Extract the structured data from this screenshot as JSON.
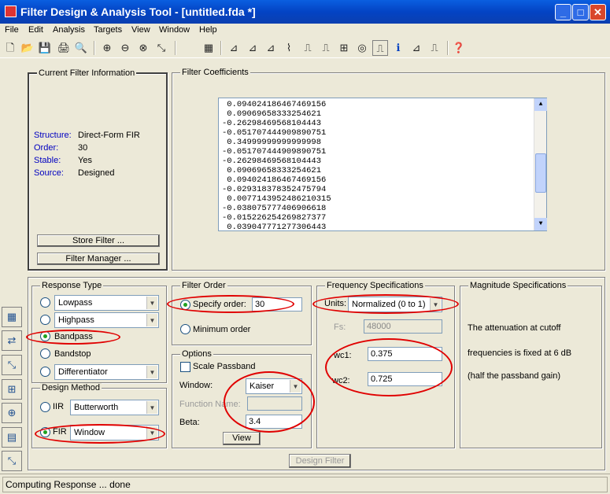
{
  "window": {
    "title": "Filter Design & Analysis Tool -  [untitled.fda *]",
    "min": "_",
    "max": "□",
    "close": "✕"
  },
  "menu": [
    "File",
    "Edit",
    "Analysis",
    "Targets",
    "View",
    "Window",
    "Help"
  ],
  "toolbar": [
    "🗋",
    "📂",
    "💾",
    "🖨",
    "🔍",
    "⊕",
    "⊖",
    "⊗",
    "⤡",
    "▦",
    "⊿",
    "⊿",
    "⊿",
    "⌇",
    "⎍",
    "⎍",
    "⊞",
    "◎",
    "⎍",
    "ℹ",
    "⊿",
    "⎍",
    "❓"
  ],
  "current": {
    "title": "Current Filter Information",
    "structure_l": "Structure:",
    "structure": "Direct-Form FIR",
    "order_l": "Order:",
    "order": "30",
    "stable_l": "Stable:",
    "stable": "Yes",
    "source_l": "Source:",
    "source": "Designed",
    "store": "Store Filter ...",
    "manager": "Filter Manager ..."
  },
  "coeffs": {
    "title": "Filter Coefficients",
    "rows": [
      " 0.094024186467469156",
      " 0.09069658333254621",
      "-0.26298469568104443",
      "-0.051707444909890751",
      " 0.34999999999999998",
      "-0.051707444909890751",
      "-0.26298469568104443",
      " 0.09069658333254621",
      " 0.094024186467469156",
      "-0.029318378352475794",
      " 0.0077143952486210315",
      "-0.038075777406906618",
      "-0.015226254269827377",
      " 0.039047771277306443"
    ]
  },
  "response": {
    "title": "Response Type",
    "lowpass": "Lowpass",
    "highpass": "Highpass",
    "bandpass": "Bandpass",
    "bandstop": "Bandstop",
    "diff": "Differentiator"
  },
  "method": {
    "title": "Design Method",
    "iir": "IIR",
    "iir_val": "Butterworth",
    "fir": "FIR",
    "fir_val": "Window"
  },
  "order": {
    "title": "Filter Order",
    "specify": "Specify order:",
    "specify_val": "30",
    "minimum": "Minimum order"
  },
  "options": {
    "title": "Options",
    "scale": "Scale Passband",
    "window_l": "Window:",
    "window_val": "Kaiser",
    "fname_l": "Function Name:",
    "beta_l": "Beta:",
    "beta_val": "3.4",
    "view": "View"
  },
  "freq": {
    "title": "Frequency Specifications",
    "units_l": "Units:",
    "units_val": "Normalized (0 to 1)",
    "fs_l": "Fs:",
    "fs_val": "48000",
    "wc1_l": "wc1:",
    "wc1_val": "0.375",
    "wc2_l": "wc2:",
    "wc2_val": "0.725"
  },
  "mag": {
    "title": "Magnitude Specifications",
    "l1": "The attenuation at cutoff",
    "l2": "frequencies is fixed at 6 dB",
    "l3": "(half the passband gain)"
  },
  "design": "Design Filter",
  "status": "Computing Response ... done",
  "colors": {
    "title": "#0343C4",
    "highlight": "#e00000"
  }
}
